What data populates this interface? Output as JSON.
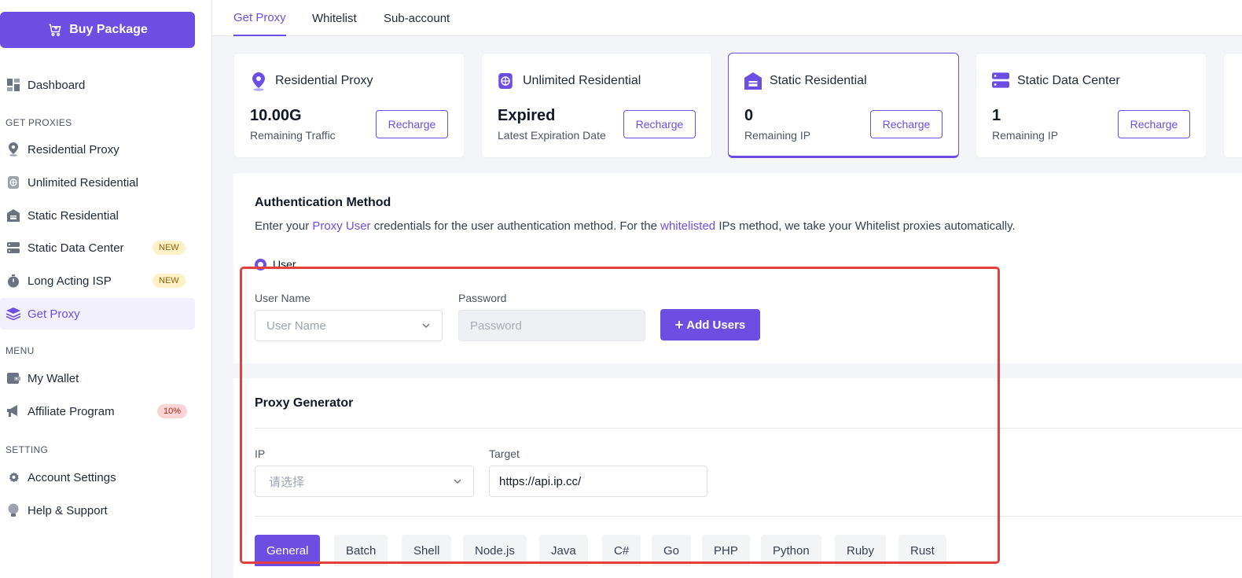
{
  "sidebar": {
    "buy_label": "Buy Package",
    "dashboard": "Dashboard",
    "section_get_proxies": "GET PROXIES",
    "residential_proxy": "Residential Proxy",
    "unlimited_residential": "Unlimited Residential",
    "static_residential": "Static Residential",
    "static_data_center": "Static Data Center",
    "long_acting_isp": "Long Acting ISP",
    "get_proxy": "Get Proxy",
    "badge_new": "NEW",
    "section_menu": "MENU",
    "my_wallet": "My Wallet",
    "affiliate_program": "Affiliate Program",
    "affiliate_badge": "10%",
    "section_setting": "SETTING",
    "account_settings": "Account Settings",
    "help_support": "Help & Support"
  },
  "tabs": {
    "get_proxy": "Get Proxy",
    "whitelist": "Whitelist",
    "sub_account": "Sub-account"
  },
  "cards": [
    {
      "title": "Residential Proxy",
      "value": "10.00G",
      "sub": "Remaining Traffic",
      "button": "Recharge"
    },
    {
      "title": "Unlimited Residential",
      "value": "Expired",
      "sub": "Latest Expiration Date",
      "button": "Recharge"
    },
    {
      "title": "Static Residential",
      "value": "0",
      "sub": "Remaining IP",
      "button": "Recharge"
    },
    {
      "title": "Static Data Center",
      "value": "1",
      "sub": "Remaining IP",
      "button": "Recharge"
    }
  ],
  "auth": {
    "title": "Authentication Method",
    "desc_1": "Enter your ",
    "desc_link_1": "Proxy User",
    "desc_2": " credentials for the user authentication method. For the ",
    "desc_link_2": "whitelisted",
    "desc_3": " IPs method, we take your Whitelist proxies automatically.",
    "radio_user": "User",
    "username_label": "User Name",
    "username_placeholder": "User Name",
    "password_label": "Password",
    "password_placeholder": "Password",
    "add_users": "Add Users"
  },
  "generator": {
    "title": "Proxy Generator",
    "ip_label": "IP",
    "ip_placeholder": "请选择",
    "target_label": "Target",
    "target_value": "https://api.ip.cc/",
    "code_tabs": [
      "General",
      "Batch",
      "Shell",
      "Node.js",
      "Java",
      "C#",
      "Go",
      "PHP",
      "Python",
      "Ruby",
      "Rust"
    ]
  },
  "colors": {
    "accent": "#6c4ee3",
    "highlight": "#e5403f"
  }
}
